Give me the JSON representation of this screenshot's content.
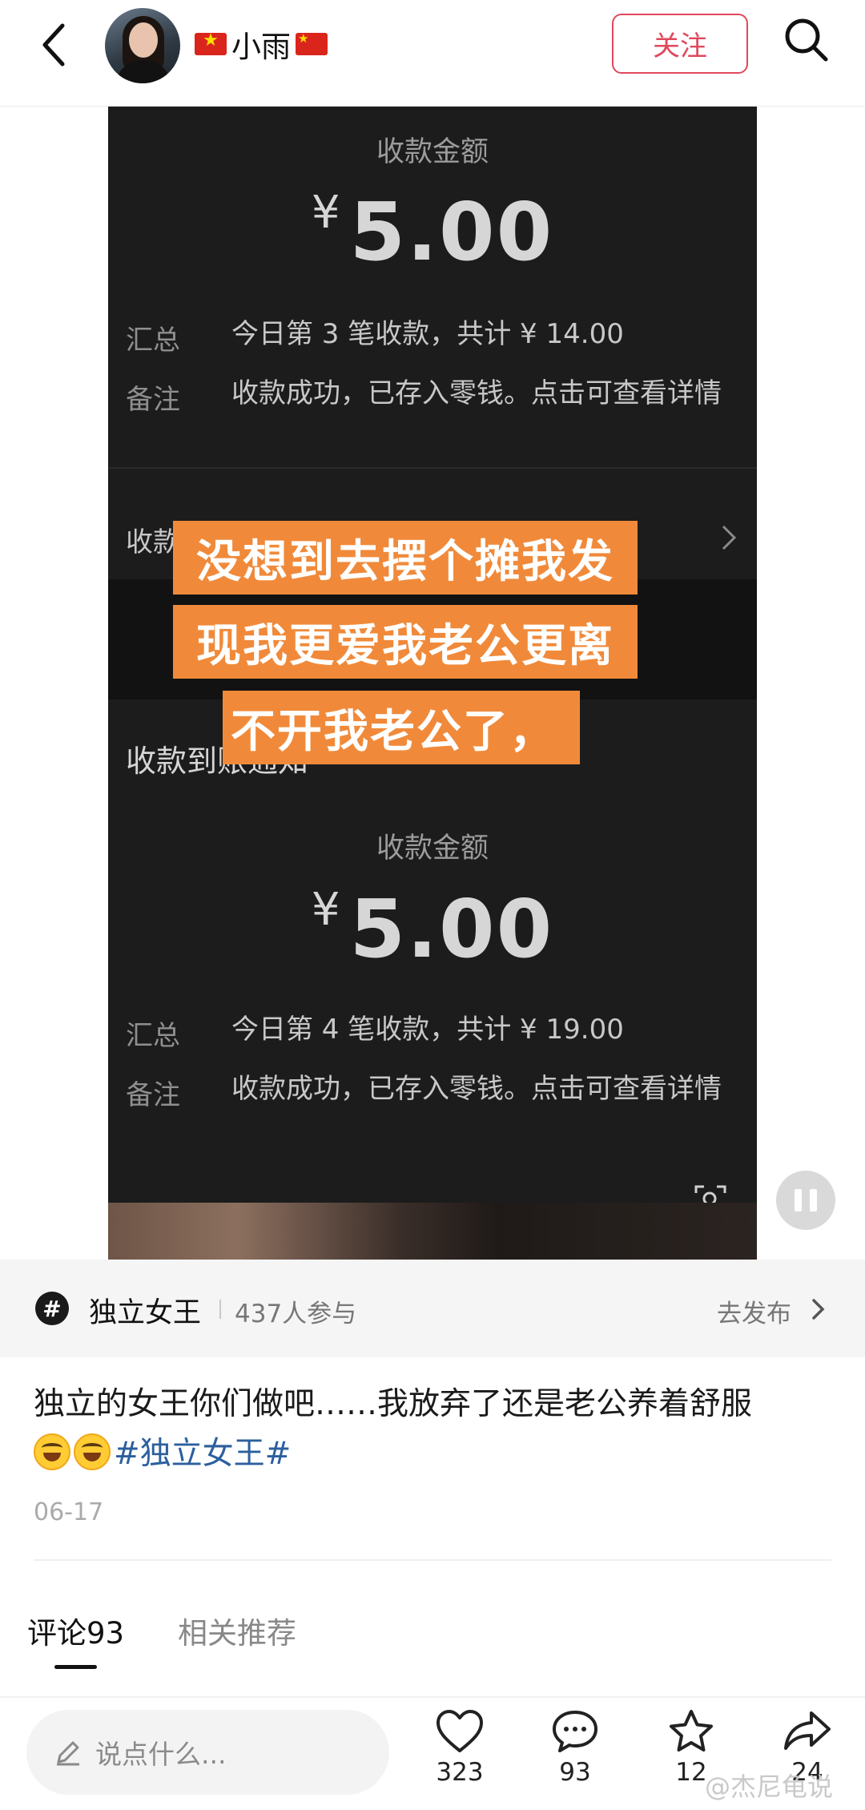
{
  "header": {
    "username": "小雨",
    "follow_label": "关注"
  },
  "video": {
    "receipt1": {
      "title": "收款金额",
      "currency": "¥",
      "amount": "5.00",
      "summary_label": "汇总",
      "summary_value": "今日第 3 笔收款，共计 ¥ 14.00",
      "note_label": "备注",
      "note_value": "收款成功，已存入零钱。点击可查看详情"
    },
    "partial_label_top": "收款",
    "partial_label_mid": "收款到账通知",
    "receipt2": {
      "title": "收款金额",
      "currency": "¥",
      "amount": "5.00",
      "summary_label": "汇总",
      "summary_value": "今日第 4 笔收款，共计 ¥ 19.00",
      "note_label": "备注",
      "note_value": "收款成功，已存入零钱。点击可查看详情"
    },
    "subtitles": [
      "没想到去摆个摊我发",
      "现我更爱我老公更离",
      "不开我老公了，"
    ],
    "subtitle_color": "#f08a3a"
  },
  "topic": {
    "name": "独立女王",
    "participants": "437人参与",
    "publish_label": "去发布"
  },
  "post": {
    "text": "独立的女王你们做吧……我放弃了还是老公养着舒服",
    "hashtag": "#独立女王#",
    "date": "06-17"
  },
  "tabs": {
    "comments": "评论93",
    "related": "相关推荐"
  },
  "bottom": {
    "placeholder": "说点什么...",
    "likes": "323",
    "comments": "93",
    "favorites": "12",
    "shares": "24"
  },
  "watermark": "@杰尼龟说",
  "colors": {
    "accent": "#e0475c",
    "hashtag": "#2c5f9e"
  }
}
